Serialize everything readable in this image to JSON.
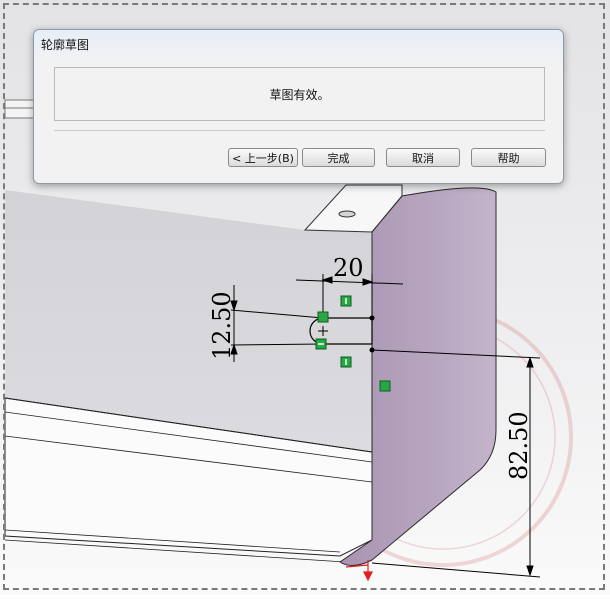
{
  "dialog": {
    "title": "轮廓草图",
    "message": "草图有效。",
    "buttons": {
      "back": "< 上一步(B)",
      "finish": "完成",
      "cancel": "取消",
      "help": "帮助"
    }
  },
  "dimensions": {
    "width": "20",
    "height": "12.50",
    "depth": "82.50"
  },
  "colors": {
    "flange_face": "#b5a3bd",
    "wall_face": "#d6d6d9",
    "relation_marker": "#27a845",
    "dimension_line": "#000000"
  }
}
